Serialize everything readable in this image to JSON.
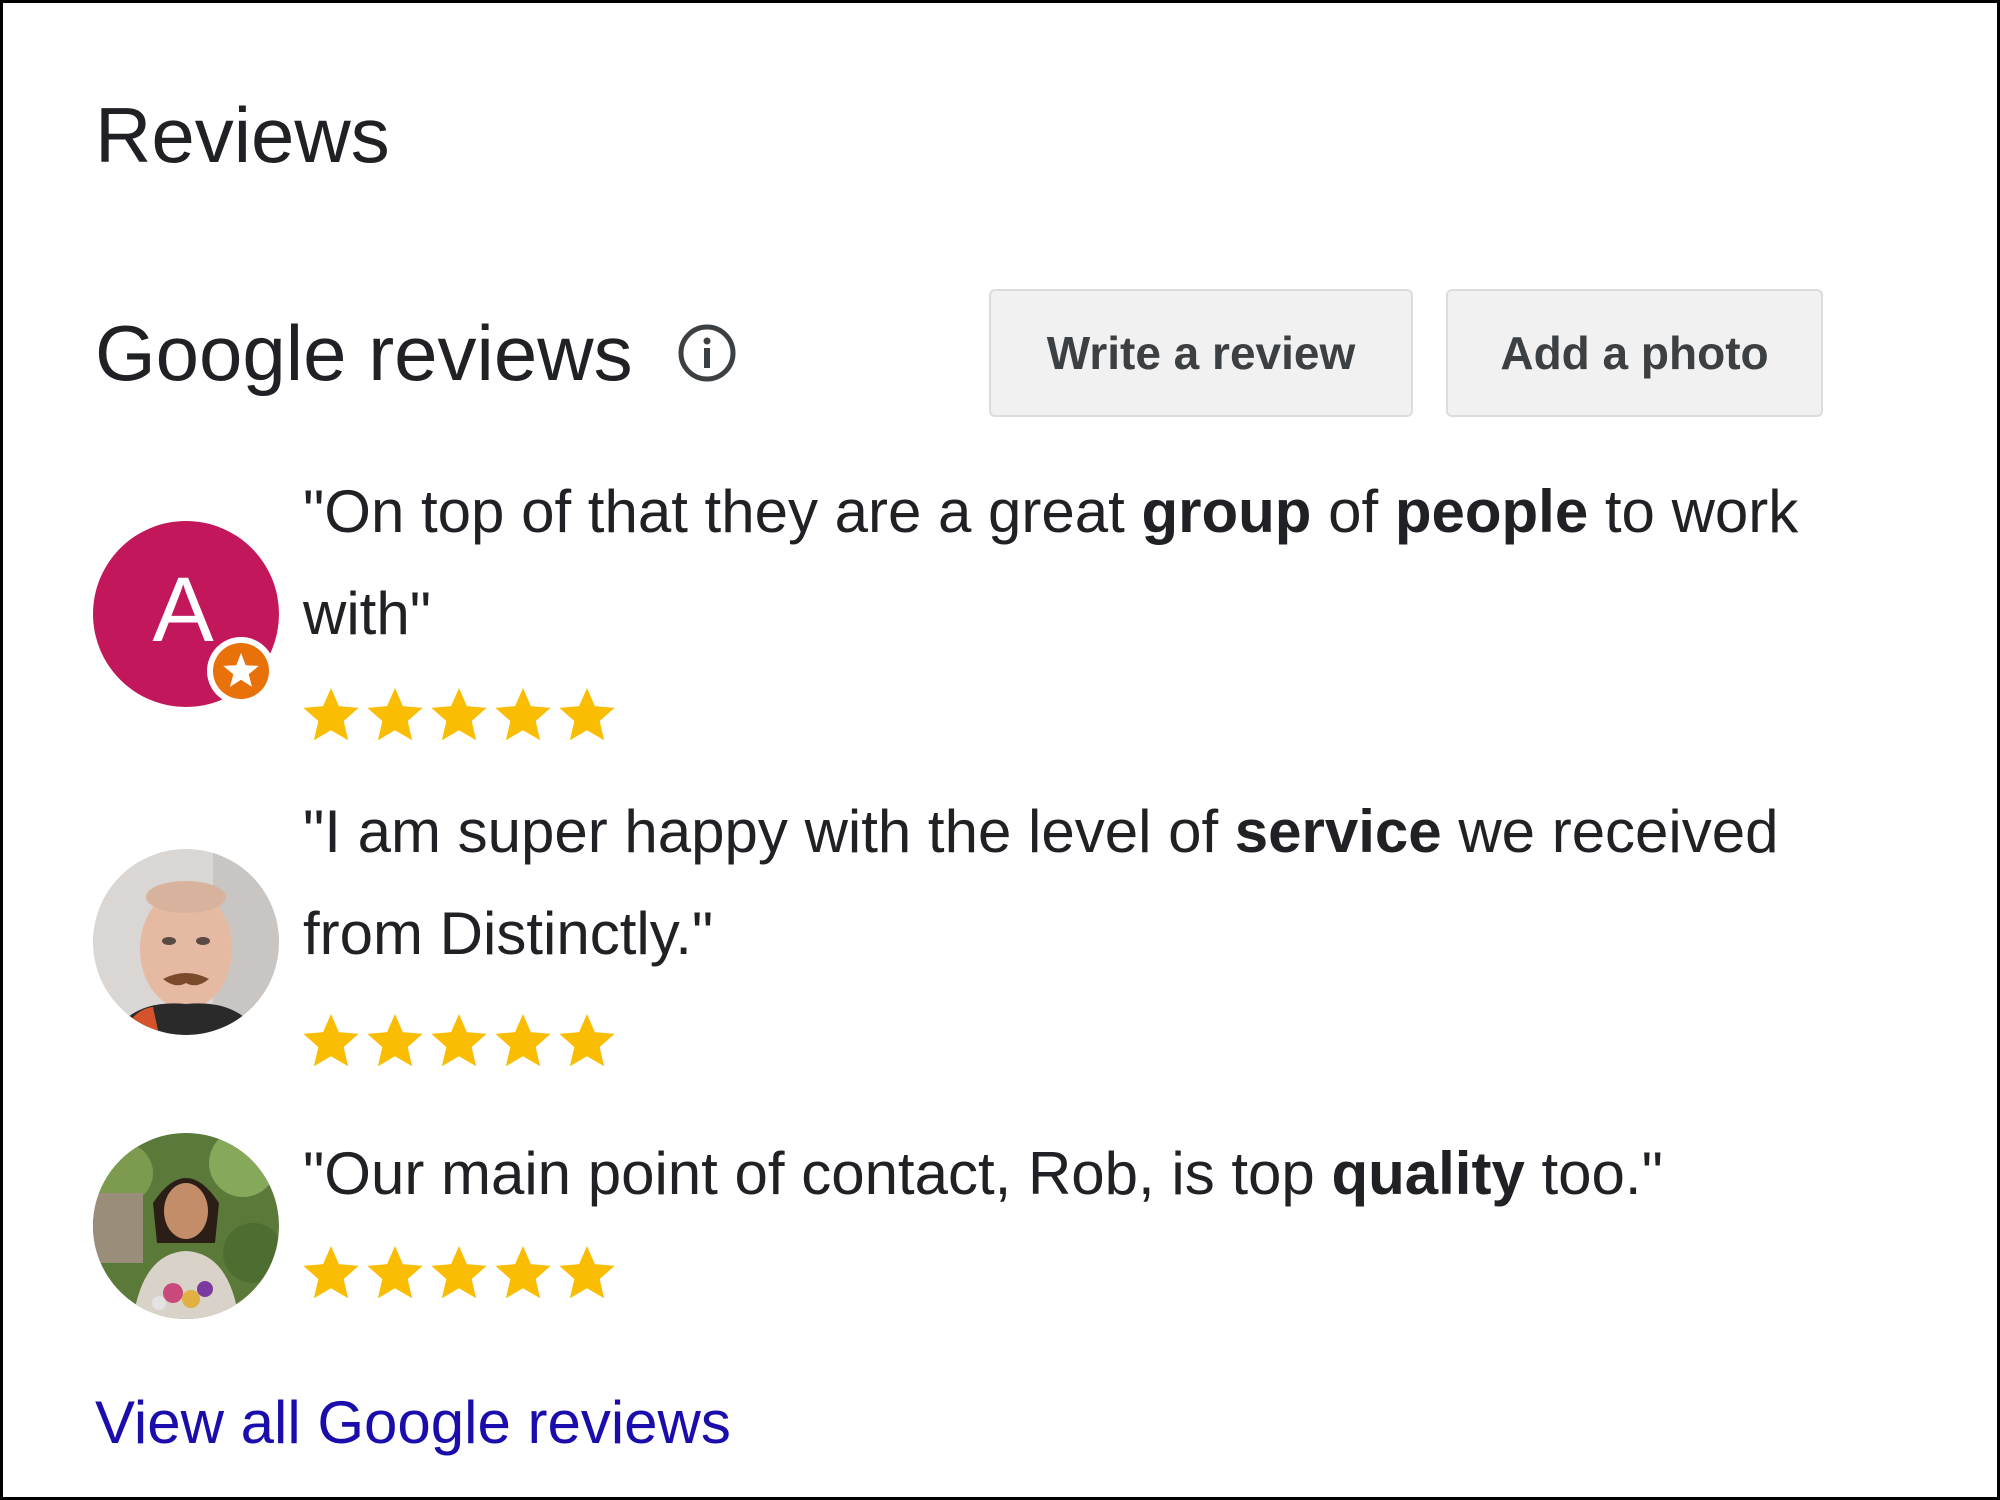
{
  "header": {
    "title": "Reviews"
  },
  "google_reviews": {
    "title": "Google reviews",
    "info_icon": "info-icon",
    "write_review_label": "Write a review",
    "add_photo_label": "Add a photo"
  },
  "reviews": [
    {
      "avatar_letter": "A",
      "avatar_color": "#c2185b",
      "badge_icon": "star-badge-icon",
      "badge_color": "#e8710a",
      "text_parts": [
        {
          "text": "\"On top of that they are a great ",
          "bold": false
        },
        {
          "text": "group",
          "bold": true
        },
        {
          "text": " of ",
          "bold": false
        },
        {
          "text": "people",
          "bold": true
        },
        {
          "text": " to work with\"",
          "bold": false
        }
      ],
      "rating": 5
    },
    {
      "avatar_icon": "user-photo-avatar",
      "text_parts": [
        {
          "text": "\"I am super happy with the level of ",
          "bold": false
        },
        {
          "text": "service",
          "bold": true
        },
        {
          "text": " we received from Distinctly.\"",
          "bold": false
        }
      ],
      "rating": 5
    },
    {
      "avatar_icon": "user-photo-avatar",
      "text_parts": [
        {
          "text": "\"Our main point of contact, Rob, is top ",
          "bold": false
        },
        {
          "text": "quality",
          "bold": true
        },
        {
          "text": " too.\"",
          "bold": false
        }
      ],
      "rating": 5
    }
  ],
  "star_color": "#fbbc04",
  "link_color": "#1a0dab",
  "view_all_label": "View all Google reviews"
}
